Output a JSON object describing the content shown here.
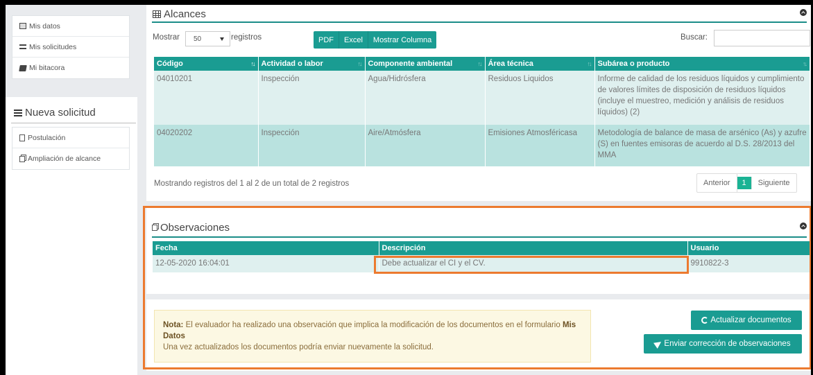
{
  "sidebar": {
    "menu": [
      {
        "label": "Mis datos",
        "icon": "id-card-icon"
      },
      {
        "label": "Mis solicitudes",
        "icon": "list-icon"
      },
      {
        "label": "Mi bitacora",
        "icon": "book-icon"
      }
    ],
    "nueva_title": "Nueva solicitud",
    "nueva_items": [
      {
        "label": "Postulación",
        "icon": "file-icon"
      },
      {
        "label": "Ampliación de alcance",
        "icon": "copy-icon"
      }
    ]
  },
  "alcances": {
    "title": "Alcances",
    "show_label": "Mostrar",
    "page_size": "50",
    "records_label": "registros",
    "buttons": [
      "PDF",
      "Excel",
      "Mostrar Columna"
    ],
    "search_label": "Buscar:",
    "search_value": "",
    "columns": [
      "Código",
      "Actividad o labor",
      "Componente ambiental",
      "Área técnica",
      "Subárea o producto"
    ],
    "rows": [
      [
        "04010201",
        "Inspección",
        "Agua/Hidrósfera",
        "Residuos Liquidos",
        "Informe de calidad de los residuos líquidos y cumplimiento de valores límites de disposición de residuos líquidos (incluye el muestreo, medición y análisis de residuos líquidos) (2)"
      ],
      [
        "04020202",
        "Inspección",
        "Aire/Atmósfera",
        "Emisiones Atmosféricasa",
        "Metodología de balance de masa de arsénico (As) y azufre (S) en fuentes emisoras de acuerdo al D.S. 28/2013 del MMA"
      ]
    ],
    "info": "Mostrando registros del 1 al 2 de un total de 2 registros",
    "pager": {
      "prev": "Anterior",
      "current": "1",
      "next": "Siguiente"
    }
  },
  "observaciones": {
    "title": "Observaciones",
    "columns": [
      "Fecha",
      "Descripción",
      "Usuario"
    ],
    "rows": [
      [
        "12-05-2020 16:04:01",
        "Debe actualizar el CI y el CV.",
        "9910822-3"
      ]
    ]
  },
  "note": {
    "label": "Nota:",
    "text1": "El evaluador ha realizado una observación que implica la modificación de los documentos en el formulario",
    "link": "Mis Datos",
    "text2": "Una vez actualizados los documentos podría enviar nuevamente la solicitud."
  },
  "actions": {
    "update": "Actualizar documentos",
    "send": "Enviar corrección de observaciones"
  },
  "colors": {
    "accent": "#1a9c92",
    "highlight": "#ec7a2f",
    "row_light": "#dff0ef",
    "row_dark": "#b9e2df"
  }
}
